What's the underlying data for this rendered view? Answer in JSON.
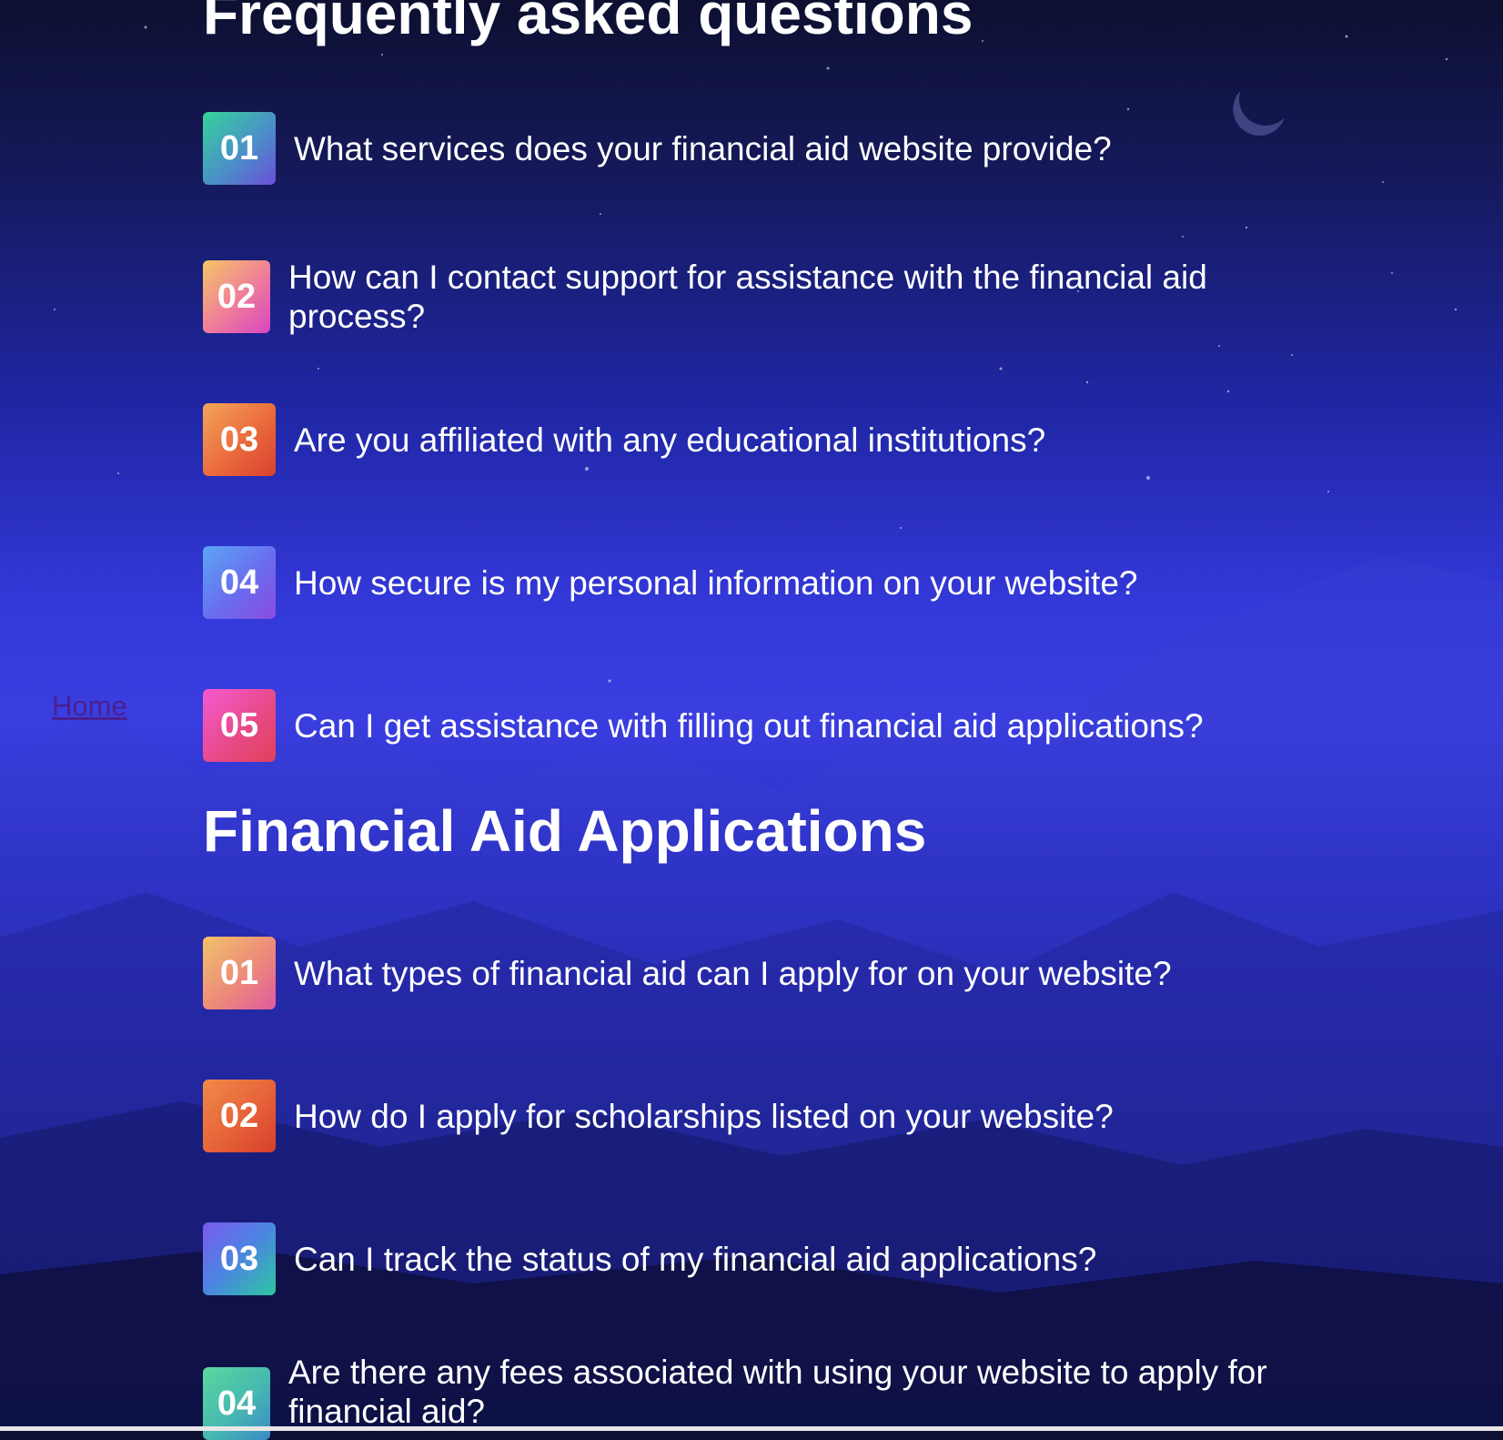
{
  "nav": {
    "home_link": "Home"
  },
  "faq": {
    "title": "Frequently asked questions",
    "items": [
      {
        "number": "01",
        "question": "What services does your financial aid website provide?"
      },
      {
        "number": "02",
        "question": "How can I contact support for assistance with the financial aid process?"
      },
      {
        "number": "03",
        "question": "Are you affiliated with any educational institutions?"
      },
      {
        "number": "04",
        "question": "How secure is my personal information on your website?"
      },
      {
        "number": "05",
        "question": "Can I get assistance with filling out financial aid applications?"
      }
    ]
  },
  "applications": {
    "title": "Financial Aid Applications",
    "items": [
      {
        "number": "01",
        "question": "What types of financial aid can I apply for on your website?"
      },
      {
        "number": "02",
        "question": "How do I apply for scholarships listed on your website?"
      },
      {
        "number": "03",
        "question": "Can I track the status of my financial aid applications?"
      },
      {
        "number": "04",
        "question": "Are there any fees associated with using your website to apply for financial aid?"
      }
    ]
  },
  "icons": {
    "moon": "moon-icon"
  }
}
